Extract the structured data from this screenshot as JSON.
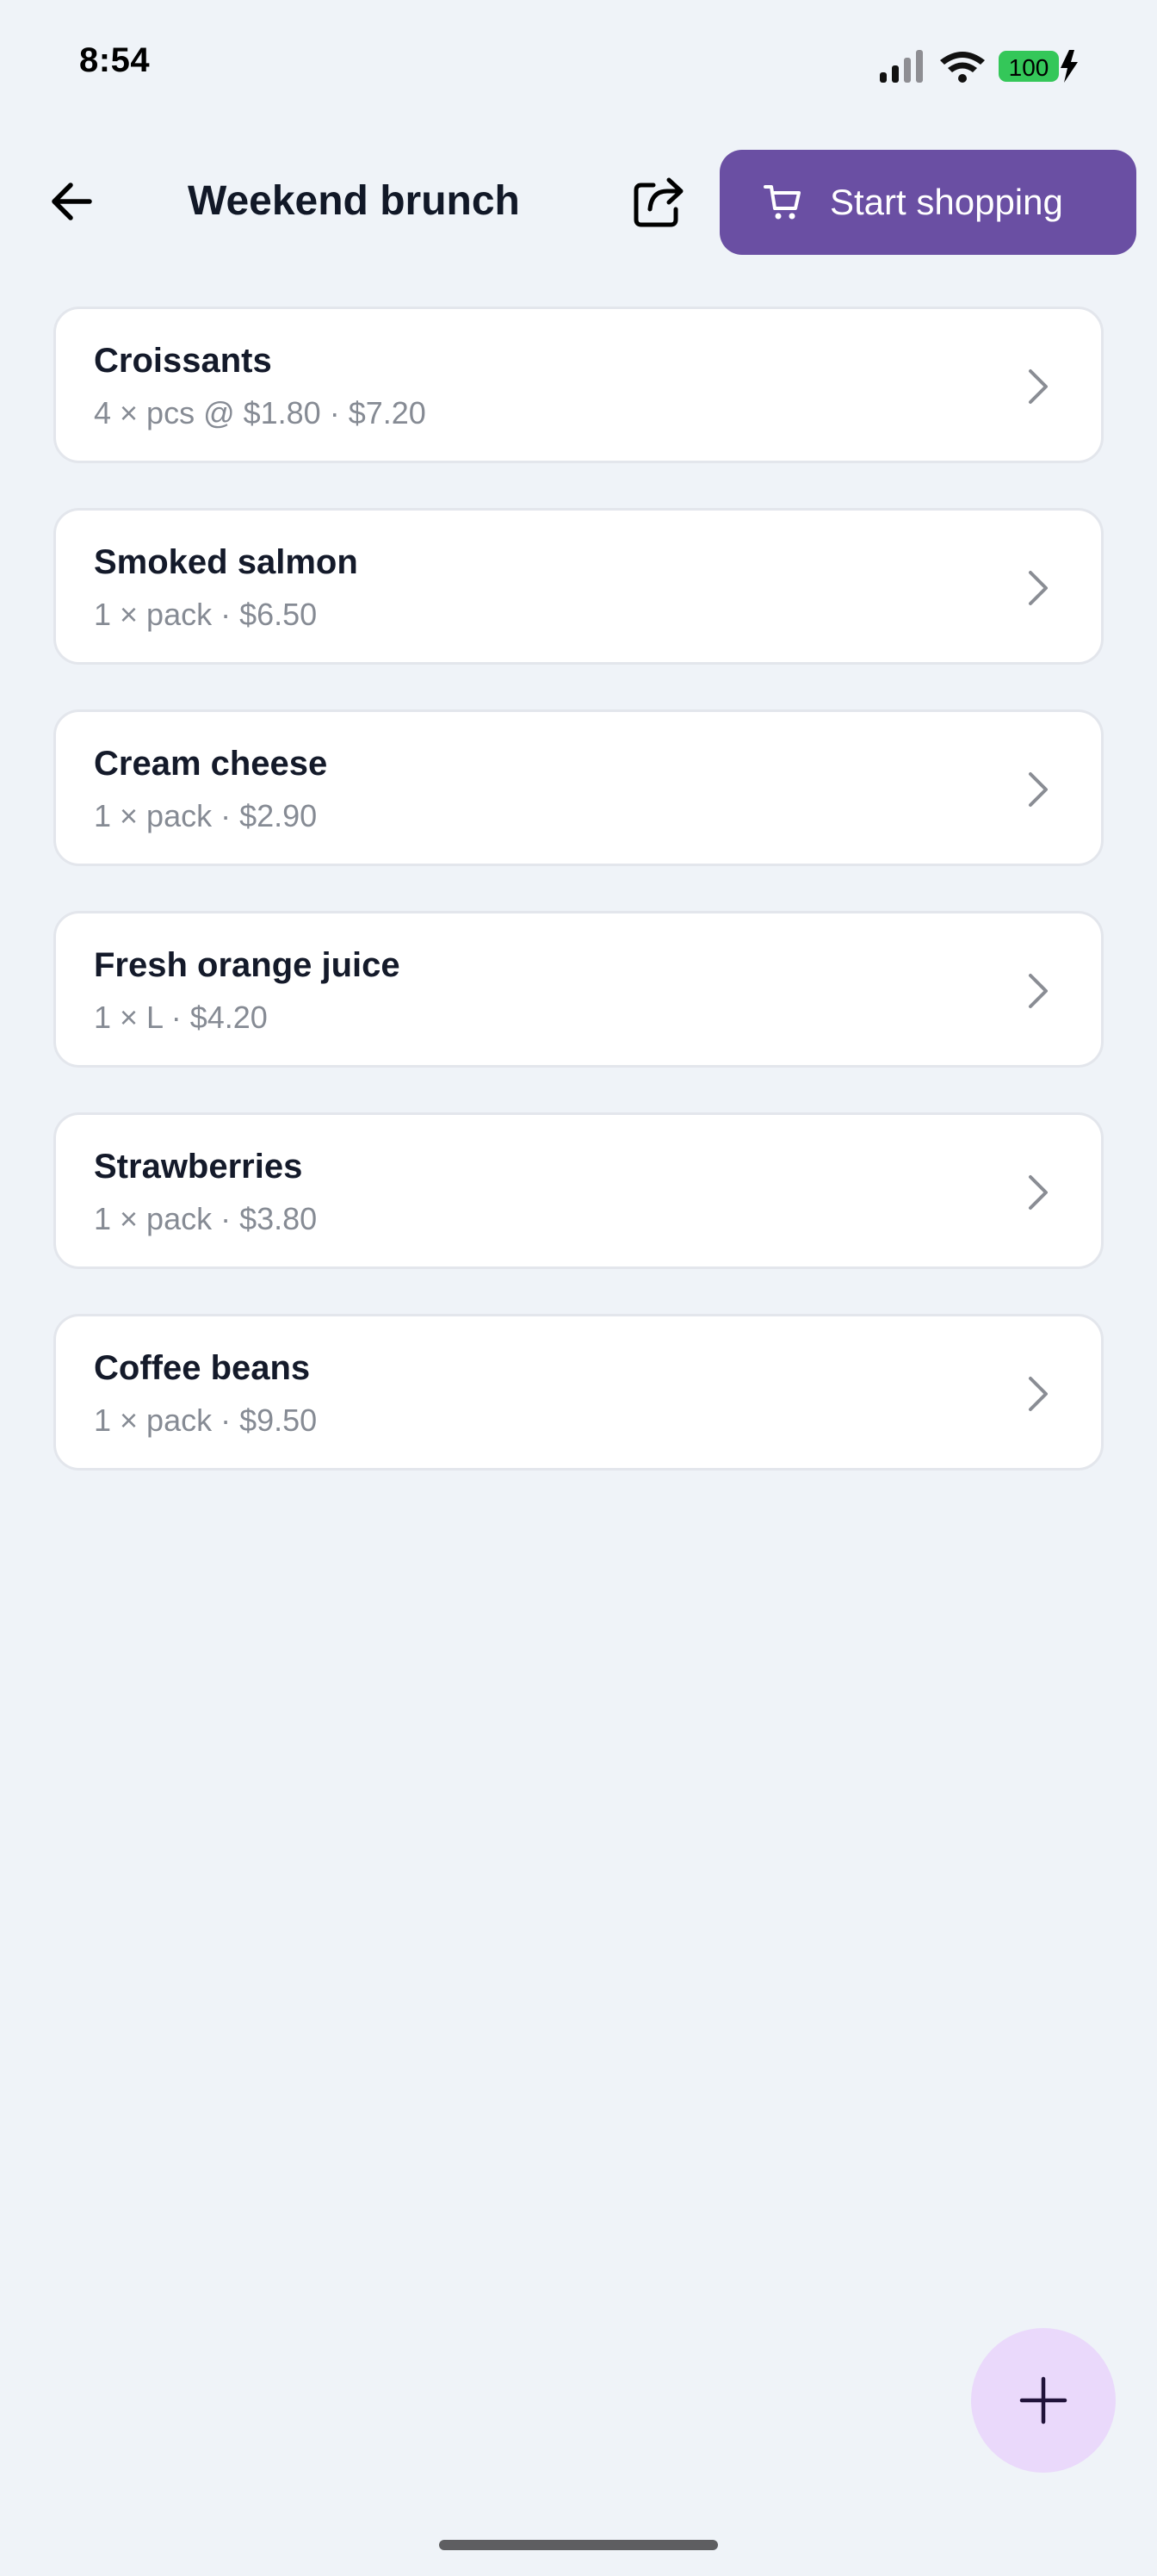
{
  "status_bar": {
    "time": "8:54",
    "battery_level": "100",
    "icons": [
      "signal-icon",
      "wifi-icon",
      "battery-icon",
      "charging-bolt-icon"
    ]
  },
  "header": {
    "back_icon": "arrow-left-icon",
    "title": "Weekend brunch",
    "share_icon": "share-icon",
    "start_shopping": {
      "icon": "cart-icon",
      "label": "Start shopping"
    }
  },
  "items": [
    {
      "name": "Croissants",
      "detail": "4 × pcs @ $1.80 · $7.20"
    },
    {
      "name": "Smoked salmon",
      "detail": "1 × pack · $6.50"
    },
    {
      "name": "Cream cheese",
      "detail": "1 × pack · $2.90"
    },
    {
      "name": "Fresh orange juice",
      "detail": "1 × L · $4.20"
    },
    {
      "name": "Strawberries",
      "detail": "1 × pack · $3.80"
    },
    {
      "name": "Coffee beans",
      "detail": "1 × pack · $9.50"
    }
  ],
  "fab": {
    "icon": "plus-icon"
  },
  "colors": {
    "background": "#eff3f8",
    "accent": "#6a4fa3",
    "fab_background": "#ead9fb",
    "battery_green": "#34c759",
    "card_border": "#e3e6ec",
    "detail_text": "#868b94"
  }
}
